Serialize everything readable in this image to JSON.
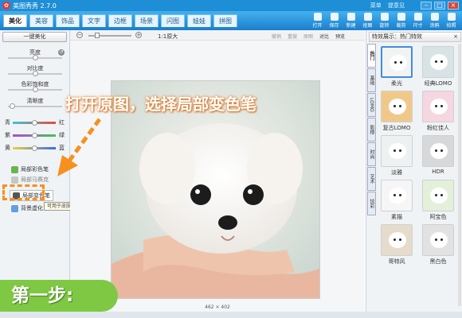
{
  "window": {
    "title": "美图秀秀 2.7.0",
    "menu_label": "菜单",
    "feedback_label": "提意见",
    "minimize": "–",
    "maximize": "□",
    "close": "×"
  },
  "tabs": [
    {
      "label": "美化",
      "active": true
    },
    {
      "label": "美容"
    },
    {
      "label": "饰品"
    },
    {
      "label": "文字"
    },
    {
      "label": "边框"
    },
    {
      "label": "场景"
    },
    {
      "label": "闪图"
    },
    {
      "label": "娃娃"
    },
    {
      "label": "拼图"
    }
  ],
  "toolbar": [
    {
      "label": "打开",
      "icon": "folder-icon"
    },
    {
      "label": "保存",
      "icon": "save-icon"
    },
    {
      "label": "新建",
      "icon": "new-icon"
    },
    {
      "label": "抠图",
      "icon": "cutout-icon"
    },
    {
      "label": "旋转",
      "icon": "rotate-icon"
    },
    {
      "label": "裁剪",
      "icon": "crop-icon"
    },
    {
      "label": "尺寸",
      "icon": "resize-icon"
    },
    {
      "label": "涂鸦",
      "icon": "doodle-icon"
    },
    {
      "label": "拍照",
      "icon": "camera-icon"
    }
  ],
  "left_panel": {
    "one_key_label": "一键美化",
    "sliders": [
      {
        "label": "亮度",
        "value": 0.5
      },
      {
        "label": "对比度",
        "value": 0.5
      },
      {
        "label": "色彩饱和度",
        "value": 0.5
      },
      {
        "label": "清晰度",
        "value": 0.05
      }
    ],
    "color_sliders": [
      {
        "left": "青",
        "right": "红",
        "value": 0.5
      },
      {
        "left": "紫",
        "right": "绿",
        "value": 0.5
      },
      {
        "left": "黄",
        "right": "蓝",
        "value": 0.5
      }
    ],
    "tools": [
      {
        "label": "局部彩色笔",
        "icon": "color-brush-icon"
      },
      {
        "label": "局部马赛克",
        "icon": "mosaic-icon"
      },
      {
        "label": "局部变色笔",
        "icon": "color-change-brush-icon"
      },
      {
        "label": "背景虚化",
        "icon": "blur-bg-icon"
      }
    ],
    "tooltip": "可用于皮肤美白、染发、眼彩等"
  },
  "canvas": {
    "zoom_minus": "−",
    "zoom_plus": "+",
    "original_label": "1:1原大",
    "edit_tools": [
      {
        "label": "撤销",
        "enabled": false
      },
      {
        "label": "重做",
        "enabled": false
      },
      {
        "label": "原图",
        "enabled": false
      },
      {
        "label": "对比",
        "enabled": true
      },
      {
        "label": "预览",
        "enabled": true
      }
    ],
    "dims": "462 × 402"
  },
  "right_panel": {
    "header": "特效展示：热门特效",
    "collapse": "×",
    "vtabs": [
      {
        "label": "热门",
        "active": true
      },
      {
        "label": "基础"
      },
      {
        "label": "LOMO"
      },
      {
        "label": "影楼"
      },
      {
        "label": "时尚"
      },
      {
        "label": "艺术"
      },
      {
        "label": "炫彩"
      }
    ],
    "effects": [
      {
        "label": "柔光",
        "selected": true,
        "tint": "#f3f3f3"
      },
      {
        "label": "经典LOMO",
        "tint": "#d8e3e6"
      },
      {
        "label": "复古LOMO",
        "tint": "#f0c98a"
      },
      {
        "label": "粉红佳人",
        "tint": "#f6d6e0"
      },
      {
        "label": "淡雅",
        "tint": "#eef1f2"
      },
      {
        "label": "HDR",
        "tint": "#d6d8da"
      },
      {
        "label": "素描",
        "tint": "#f6f6f6"
      },
      {
        "label": "阿宝色",
        "tint": "#e4f0da"
      },
      {
        "label": "哥特风",
        "tint": "#e6dccb"
      },
      {
        "label": "黑白色",
        "tint": "#e2e2e2"
      }
    ]
  },
  "annotation": {
    "text": "打开原图，选择局部变色笔",
    "step": "第一步:"
  }
}
